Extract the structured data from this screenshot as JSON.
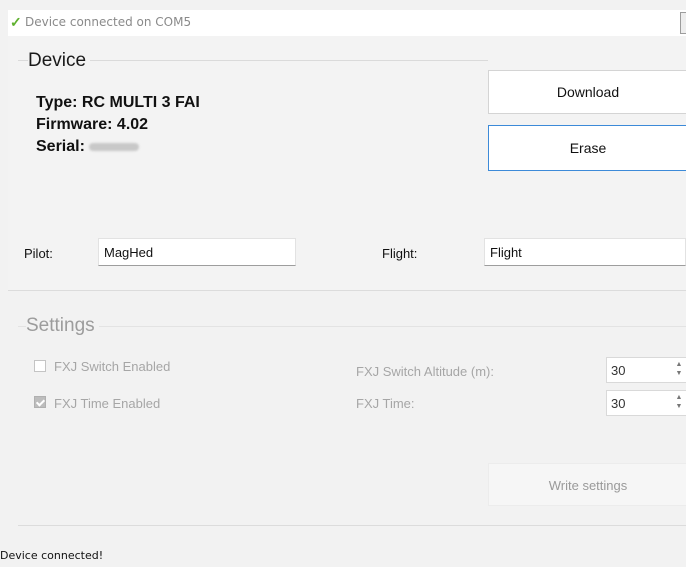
{
  "titlebar": {
    "title": "Device connected on COM5",
    "check_icon": "checkmark-icon",
    "close_glyph": "X"
  },
  "device": {
    "legend": "Device",
    "type_line": "Type: RC MULTI 3 FAI",
    "firmware_line": "Firmware: 4.02",
    "serial_label": "Serial:",
    "download_label": "Download",
    "erase_label": "Erase",
    "pilot_label": "Pilot:",
    "pilot_value": "MagHed",
    "flight_label": "Flight:",
    "flight_value": "Flight"
  },
  "settings": {
    "legend": "Settings",
    "fxj_switch_label": "FXJ Switch Enabled",
    "fxj_switch_checked": false,
    "fxj_time_label": "FXJ Time Enabled",
    "fxj_time_checked": true,
    "switch_altitude_label": "FXJ Switch Altitude (m):",
    "switch_altitude_value": "30",
    "fxj_time_field_label": "FXJ Time:",
    "fxj_time_value": "30",
    "write_label": "Write settings"
  },
  "statusbar": {
    "text": "Device connected!"
  },
  "colors": {
    "accent_border": "#3c8ad8",
    "check_green": "#5fb12f",
    "disabled_text": "#a6a6a6"
  }
}
